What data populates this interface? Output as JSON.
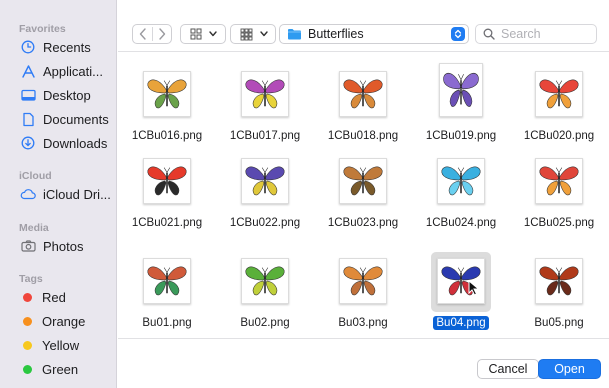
{
  "sidebar": {
    "favorites_header": "Favorites",
    "favorites": [
      {
        "label": "Recents",
        "icon": "clock-icon"
      },
      {
        "label": "Applicati...",
        "icon": "applications-icon"
      },
      {
        "label": "Desktop",
        "icon": "desktop-icon"
      },
      {
        "label": "Documents",
        "icon": "document-icon"
      },
      {
        "label": "Downloads",
        "icon": "download-icon"
      }
    ],
    "icloud_header": "iCloud",
    "icloud": [
      {
        "label": "iCloud Dri...",
        "icon": "cloud-icon"
      }
    ],
    "media_header": "Media",
    "media": [
      {
        "label": "Photos",
        "icon": "camera-icon"
      }
    ],
    "tags_header": "Tags",
    "tags": [
      {
        "label": "Red",
        "color": "#f0463c"
      },
      {
        "label": "Orange",
        "color": "#f7901e"
      },
      {
        "label": "Yellow",
        "color": "#f7c81e"
      },
      {
        "label": "Green",
        "color": "#2bc840"
      }
    ]
  },
  "toolbar": {
    "back_icon": "chevron-left-icon",
    "forward_icon": "chevron-right-icon",
    "view_icon": "grid-icon",
    "group_icon": "group-grid-icon",
    "folder_name": "Butterflies",
    "folder_color": "#2f9bf0",
    "search_placeholder": "Search"
  },
  "files": [
    {
      "name": "1CBu016.png",
      "colors": [
        "#e8a33a",
        "#6aa24a"
      ],
      "tall": false
    },
    {
      "name": "1CBu017.png",
      "colors": [
        "#b24bb8",
        "#e8d33a"
      ],
      "tall": false
    },
    {
      "name": "1CBu018.png",
      "colors": [
        "#e05a2a",
        "#d98a3a"
      ],
      "tall": false
    },
    {
      "name": "1CBu019.png",
      "colors": [
        "#8a6ad0",
        "#6a4fb5"
      ],
      "tall": true
    },
    {
      "name": "1CBu020.png",
      "colors": [
        "#e8463a",
        "#f0a03a"
      ],
      "tall": false
    },
    {
      "name": "1CBu021.png",
      "colors": [
        "#e63a2a",
        "#2a2a2a"
      ],
      "tall": false
    },
    {
      "name": "1CBu022.png",
      "colors": [
        "#5a4ab0",
        "#e0c83a"
      ],
      "tall": false
    },
    {
      "name": "1CBu023.png",
      "colors": [
        "#c07a3a",
        "#7a5a2a"
      ],
      "tall": false
    },
    {
      "name": "1CBu024.png",
      "colors": [
        "#3ab0e0",
        "#6ad0f0"
      ],
      "tall": false
    },
    {
      "name": "1CBu025.png",
      "colors": [
        "#e0463a",
        "#f0a03a"
      ],
      "tall": false
    },
    {
      "name": "Bu01.png",
      "colors": [
        "#d05a3a",
        "#3a9a5a"
      ],
      "tall": false
    },
    {
      "name": "Bu02.png",
      "colors": [
        "#5ab03a",
        "#c0d03a"
      ],
      "tall": false
    },
    {
      "name": "Bu03.png",
      "colors": [
        "#e08a3a",
        "#c0703a"
      ],
      "tall": false
    },
    {
      "name": "Bu04.png",
      "colors": [
        "#2a3ab0",
        "#d0303a"
      ],
      "tall": false,
      "selected": true
    },
    {
      "name": "Bu05.png",
      "colors": [
        "#b03a1a",
        "#6a2a1a"
      ],
      "tall": false
    }
  ],
  "buttons": {
    "cancel": "Cancel",
    "open": "Open",
    "accent": "#1f7cf2"
  }
}
